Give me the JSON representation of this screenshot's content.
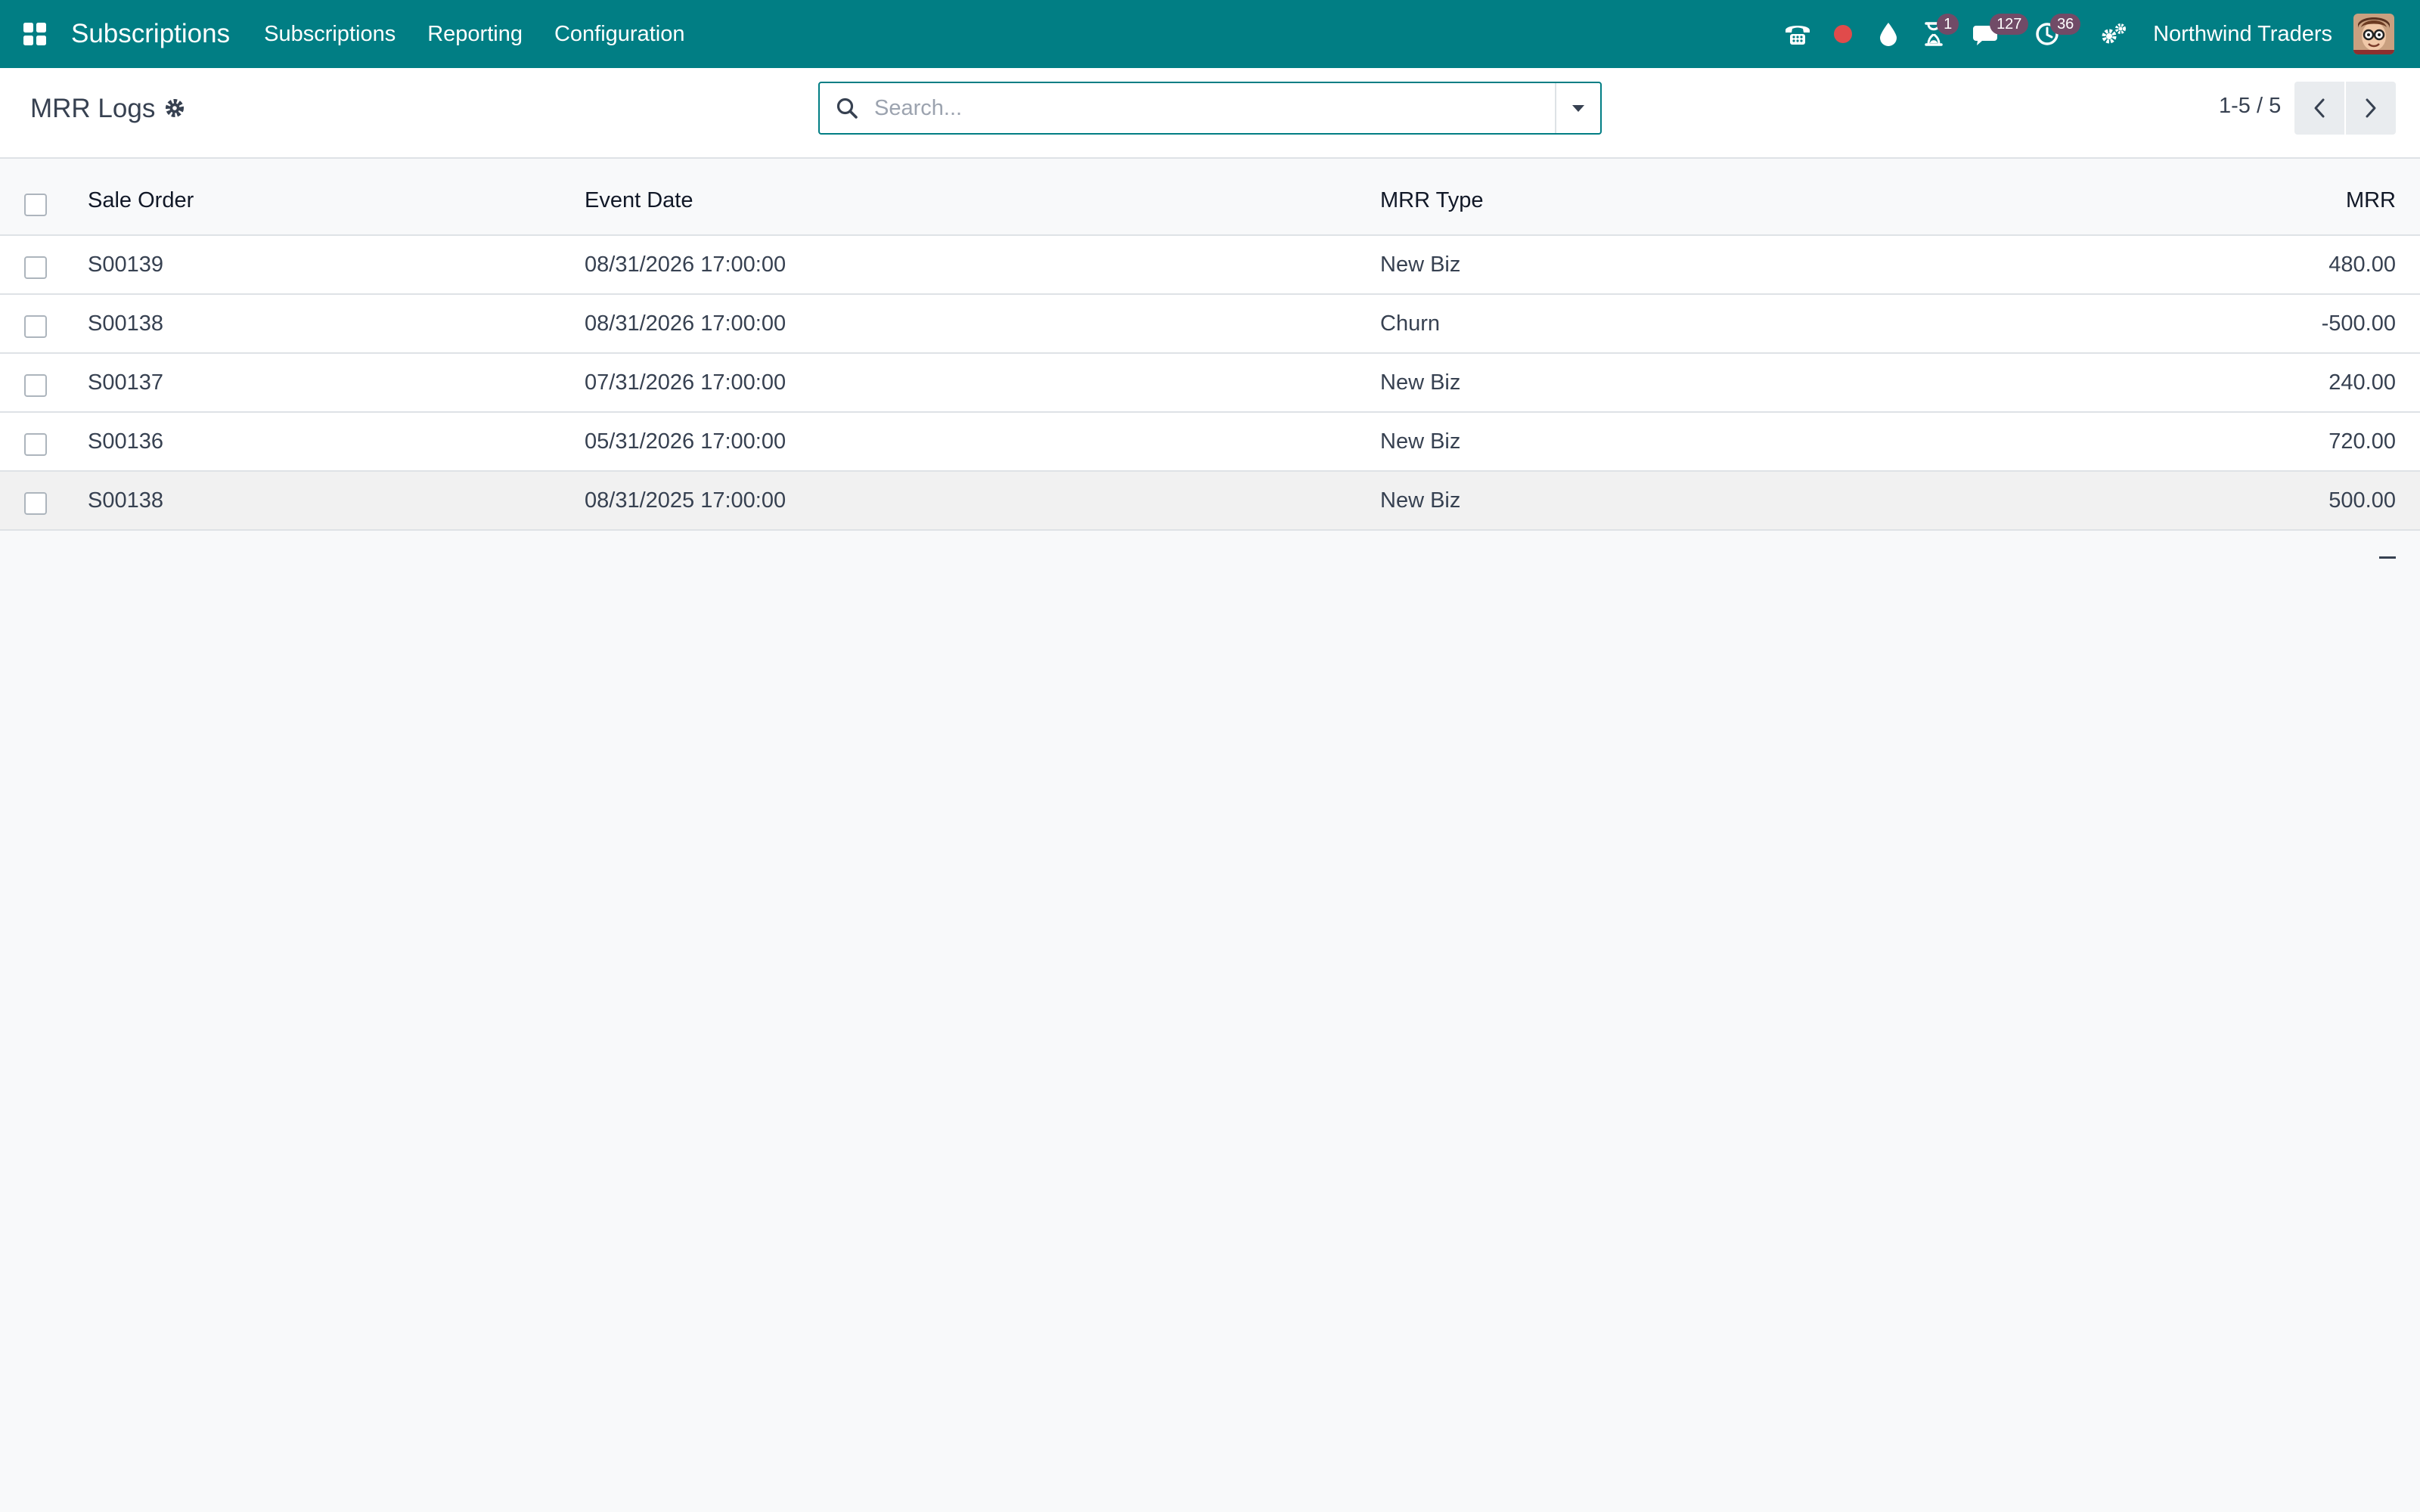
{
  "navbar": {
    "brand": "Subscriptions",
    "menu": [
      {
        "label": "Subscriptions"
      },
      {
        "label": "Reporting"
      },
      {
        "label": "Configuration"
      }
    ],
    "badges": {
      "activities": "1",
      "messages": "127",
      "timer": "36"
    },
    "company": "Northwind Traders",
    "colors": {
      "brand": "#017e84",
      "badge": "#714b67",
      "record": "#e04b4b"
    }
  },
  "control_panel": {
    "title": "MRR Logs",
    "search": {
      "placeholder": "Search...",
      "value": ""
    },
    "pager": {
      "value": "1-5 / 5"
    }
  },
  "list": {
    "columns": {
      "sale_order": "Sale Order",
      "event_date": "Event Date",
      "mrr_type": "MRR Type",
      "mrr": "MRR"
    },
    "rows": [
      {
        "sale_order": "S00139",
        "event_date": "08/31/2026 17:00:00",
        "mrr_type": "New Biz",
        "mrr": "480.00"
      },
      {
        "sale_order": "S00138",
        "event_date": "08/31/2026 17:00:00",
        "mrr_type": "Churn",
        "mrr": "-500.00"
      },
      {
        "sale_order": "S00137",
        "event_date": "07/31/2026 17:00:00",
        "mrr_type": "New Biz",
        "mrr": "240.00"
      },
      {
        "sale_order": "S00136",
        "event_date": "05/31/2026 17:00:00",
        "mrr_type": "New Biz",
        "mrr": "720.00"
      },
      {
        "sale_order": "S00138",
        "event_date": "08/31/2025 17:00:00",
        "mrr_type": "New Biz",
        "mrr": "500.00"
      }
    ]
  }
}
